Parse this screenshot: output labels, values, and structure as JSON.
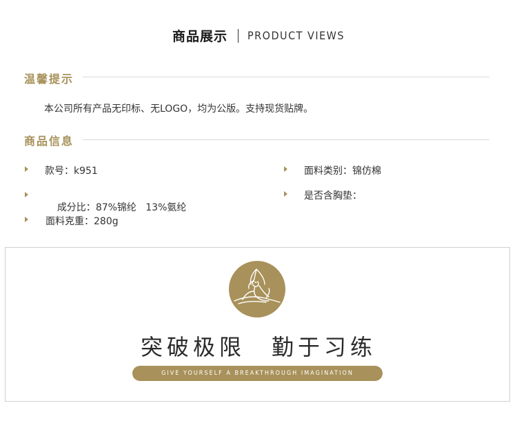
{
  "header": {
    "title_cn": "商品展示",
    "title_en": "PRODUCT VIEWS"
  },
  "notice": {
    "title": "温馨提示",
    "text": "本公司所有产品无印标、无LOGO，均为公版。支持现货贴牌。"
  },
  "product_info": {
    "title": "商品信息",
    "items": [
      {
        "label": "款号：",
        "value": "k951"
      },
      {
        "label": "面料类别：",
        "value": "锦仿棉"
      },
      {
        "label": "成分比：",
        "value": "87%锦纶   13%氨纶"
      },
      {
        "label": "是否含胸垫：",
        "value": ""
      },
      {
        "label": "面料克重：",
        "value": "280g"
      }
    ]
  },
  "banner": {
    "slogan_left": "突破极限",
    "slogan_right": "勤于习练",
    "tagline": "GIVE YOURSELF A BREAKTHROUGH IMAGINATION"
  },
  "colors": {
    "accent_gold": "#a8915a",
    "text": "#333333",
    "divider": "#d9d9d9"
  }
}
